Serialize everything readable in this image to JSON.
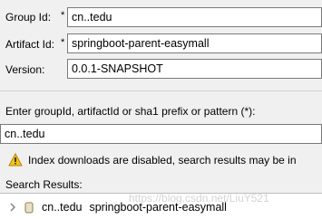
{
  "form": {
    "group_id": {
      "label": "Group Id:",
      "required_mark": "*",
      "value": "cn..tedu"
    },
    "artifact_id": {
      "label": "Artifact Id:",
      "required_mark": "*",
      "value": "springboot-parent-easymall"
    },
    "version": {
      "label": "Version:",
      "value": "0.0.1-SNAPSHOT"
    }
  },
  "search": {
    "prompt": "Enter groupId, artifactId or sha1 prefix or pattern (*):",
    "value": "cn..tedu"
  },
  "warning": {
    "icon": "warning-icon",
    "text": "Index downloads are disabled, search results may be in"
  },
  "results": {
    "title": "Search Results:",
    "items": [
      {
        "group": "cn..tedu",
        "artifact": "springboot-parent-easymall",
        "icon": "jar-icon",
        "expander": "chevron-right-icon"
      }
    ]
  },
  "watermark": "https://blog.csdn.net/LiuY521",
  "colors": {
    "warning_fill": "#f5c21b",
    "warning_stroke": "#b58600",
    "field_border": "#7a7a7a",
    "jar_fill": "#e8e0c8"
  }
}
